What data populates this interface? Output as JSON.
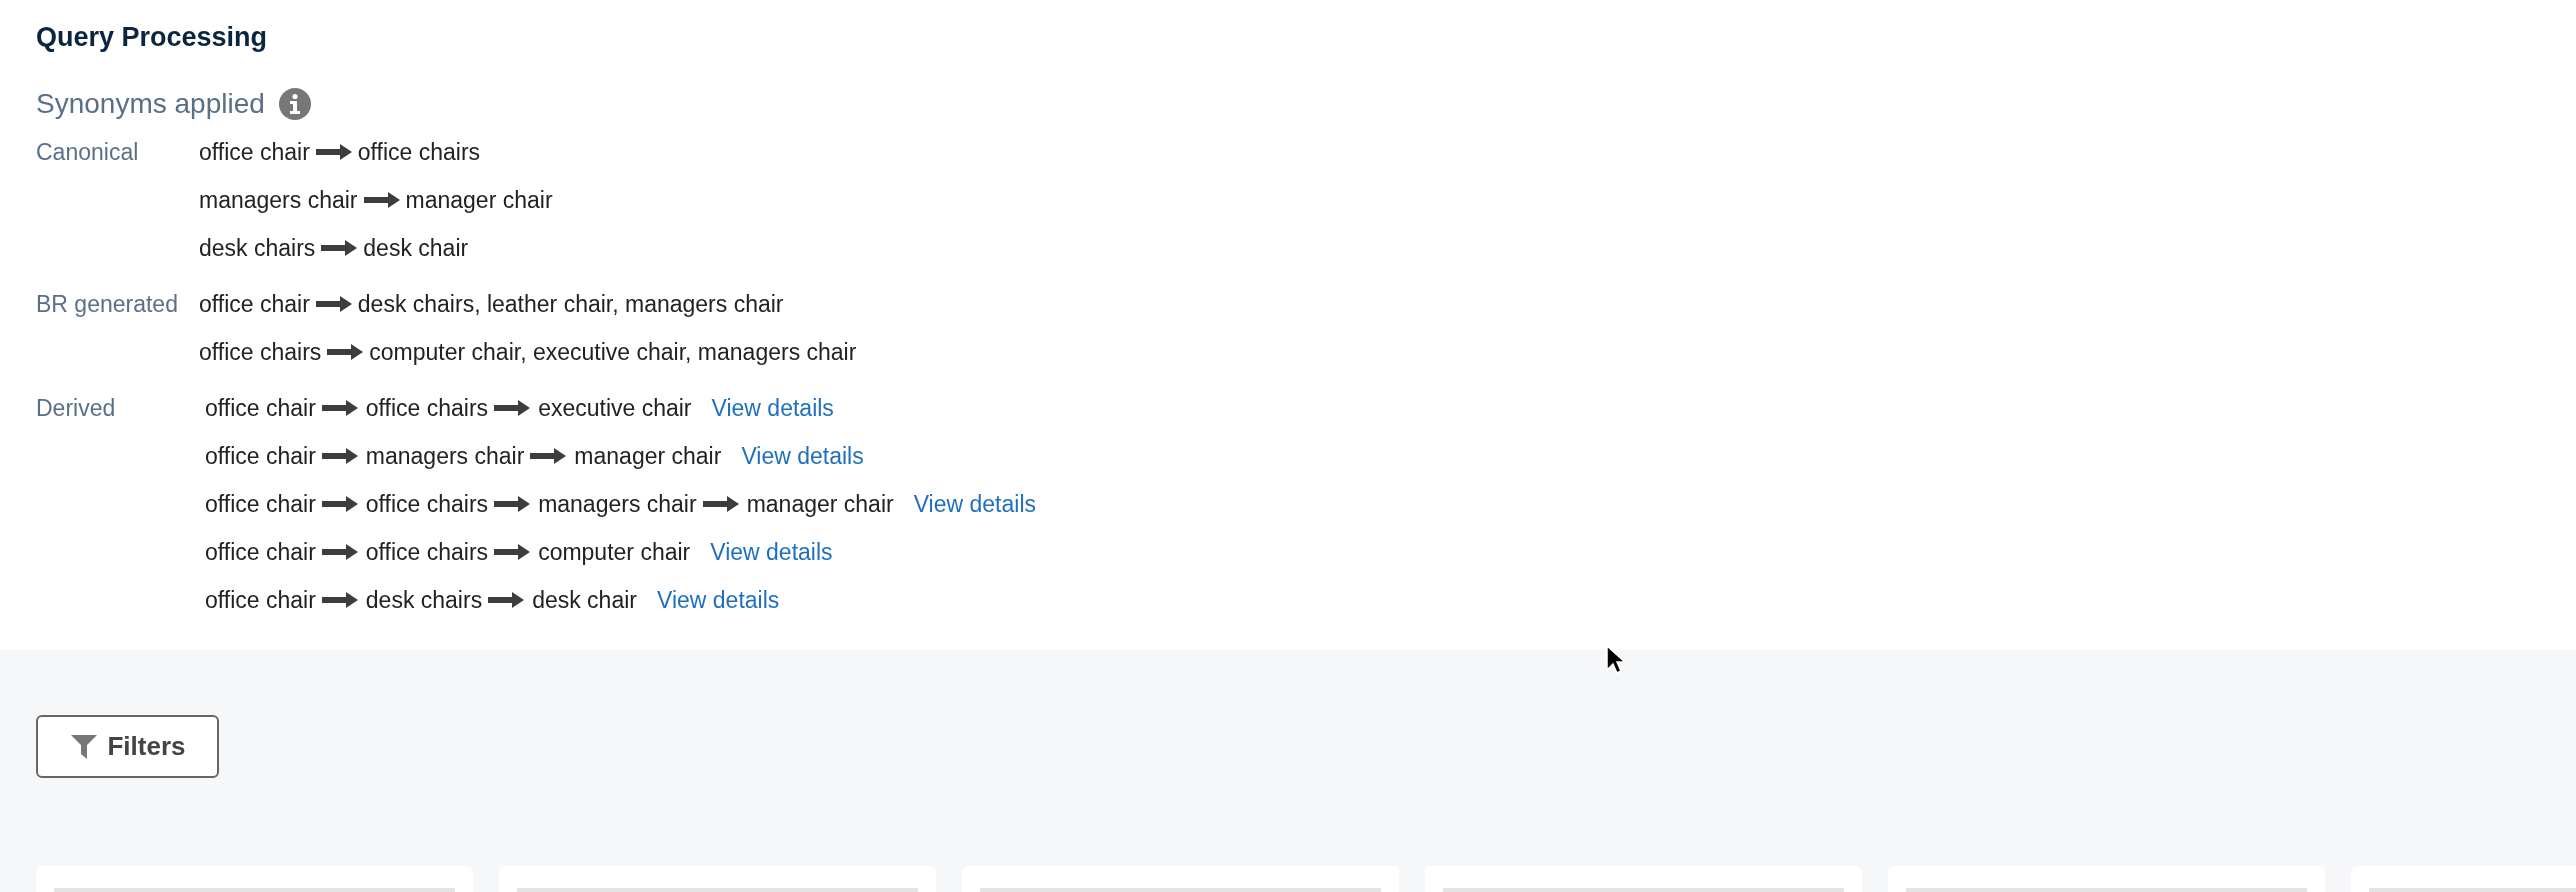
{
  "section_title": "Query Processing",
  "synonyms_heading": "Synonyms applied",
  "groups": [
    {
      "label": "Canonical",
      "rows": [
        {
          "terms": [
            "office chair",
            "office chairs"
          ]
        },
        {
          "terms": [
            "managers chair",
            "manager chair"
          ]
        },
        {
          "terms": [
            "desk chairs",
            "desk chair"
          ]
        }
      ]
    },
    {
      "label": "BR generated",
      "rows": [
        {
          "terms": [
            "office chair",
            "desk chairs, leather chair, managers chair"
          ]
        },
        {
          "terms": [
            "office chairs",
            "computer chair, executive chair, managers chair"
          ]
        }
      ]
    },
    {
      "label": "Derived",
      "rows": [
        {
          "terms": [
            "office chair",
            "office chairs",
            "executive chair"
          ],
          "link": "View details"
        },
        {
          "terms": [
            "office chair",
            "managers chair",
            "manager chair"
          ],
          "link": "View details"
        },
        {
          "terms": [
            "office chair",
            "office chairs",
            "managers chair",
            "manager chair"
          ],
          "link": "View details"
        },
        {
          "terms": [
            "office chair",
            "office chairs",
            "computer chair"
          ],
          "link": "View details"
        },
        {
          "terms": [
            "office chair",
            "desk chairs",
            "desk chair"
          ],
          "link": "View details"
        }
      ]
    }
  ],
  "filters_button": "Filters"
}
